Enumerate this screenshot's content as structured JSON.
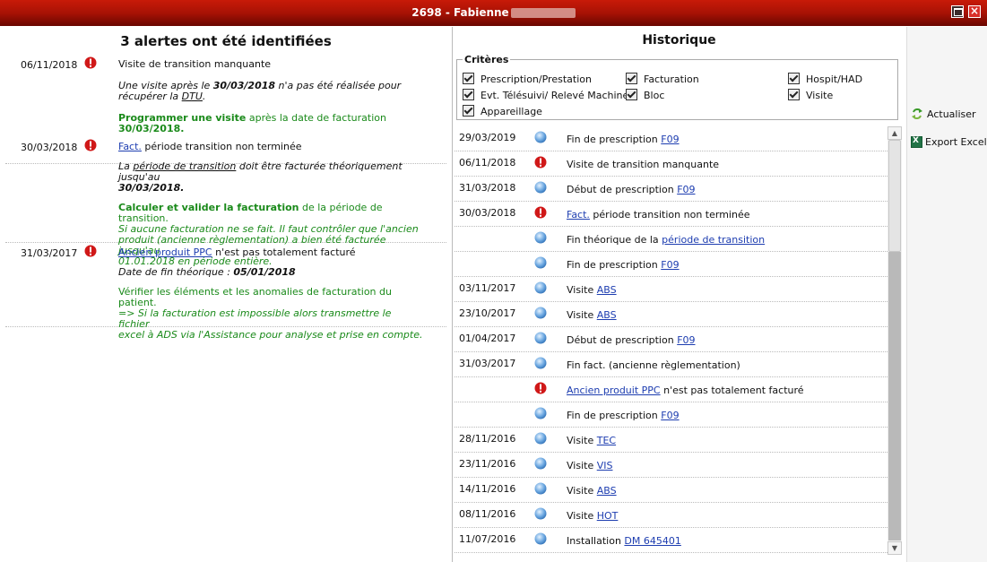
{
  "window": {
    "title": "2698 - Fabienne",
    "close_label": "×"
  },
  "alerts_panel": {
    "heading": "3 alertes ont été identifiées",
    "alerts": [
      {
        "date": "06/11/2018",
        "title": "Visite de transition manquante",
        "p1": "Une visite après le ",
        "p1b": "30/03/2018",
        "p1c": " n'a pas été réalisée pour",
        "p1d": "récupérer la ",
        "p1link": "DTU",
        "p1e": ".",
        "g1b": "Programmer une visite",
        "g1": " après la date de facturation",
        "g2b": "30/03/2018."
      },
      {
        "date": "30/03/2018",
        "title_link": "Fact.",
        "title": " période transition non terminée",
        "p1": "La ",
        "p1u": "période de transition",
        "p1c": " doit être facturée théoriquement jusqu'au",
        "p1b": "30/03/2018.",
        "g1b": "Calculer et valider la facturation",
        "g1": " de la période de transition.",
        "g2": "Si aucune facturation ne se fait. Il faut contrôler que l'ancien",
        "g3": "produit (ancienne règlementation) a bien été facturée jusqu'au",
        "g4": "01.01.2018 en période entière."
      },
      {
        "date": "31/03/2017",
        "title_link": "Ancien produit PPC",
        "title": " n'est pas totalement facturé",
        "p1": "Date de fin théorique : ",
        "p1b": "05/01/2018",
        "g1": "Vérifier les éléments et les anomalies de facturation du patient.",
        "g2": " => Si la facturation est impossible alors transmettre le fichier",
        "g3": "excel à ADS via l'Assistance pour analyse et prise en compte."
      }
    ]
  },
  "history_panel": {
    "heading": "Historique",
    "criteria_legend": "Critères",
    "criteria": [
      "Prescription/Prestation",
      "Facturation",
      "Hospit/HAD",
      "Evt. Télésuivi/ Relevé Machine",
      "Bloc",
      "Visite",
      "Appareillage"
    ],
    "rows": [
      {
        "date": "29/03/2019",
        "icon": "info",
        "text": "Fin de prescription ",
        "link": "F09",
        "after": ""
      },
      {
        "date": "06/11/2018",
        "icon": "error",
        "text": "Visite de transition manquante",
        "link": "",
        "after": ""
      },
      {
        "date": "31/03/2018",
        "icon": "info",
        "text": "Début de prescription ",
        "link": "F09",
        "after": ""
      },
      {
        "date": "30/03/2018",
        "icon": "error",
        "text": "",
        "link": "Fact.",
        "after": " période transition non terminée"
      },
      {
        "date": "",
        "icon": "info",
        "text": "Fin théorique de la ",
        "link": "période de transition",
        "after": ""
      },
      {
        "date": "",
        "icon": "info",
        "text": "Fin de prescription ",
        "link": "F09",
        "after": ""
      },
      {
        "date": "03/11/2017",
        "icon": "info",
        "text": "Visite ",
        "link": "ABS",
        "after": ""
      },
      {
        "date": "23/10/2017",
        "icon": "info",
        "text": "Visite ",
        "link": "ABS",
        "after": ""
      },
      {
        "date": "01/04/2017",
        "icon": "info",
        "text": "Début de prescription ",
        "link": "F09",
        "after": ""
      },
      {
        "date": "31/03/2017",
        "icon": "info",
        "text": "Fin fact. (ancienne règlementation)",
        "link": "",
        "after": ""
      },
      {
        "date": "",
        "icon": "error",
        "text": "",
        "link": "Ancien produit PPC",
        "after": " n'est pas totalement facturé"
      },
      {
        "date": "",
        "icon": "info",
        "text": "Fin de prescription ",
        "link": "F09",
        "after": ""
      },
      {
        "date": "28/11/2016",
        "icon": "info",
        "text": "Visite ",
        "link": "TEC",
        "after": ""
      },
      {
        "date": "23/11/2016",
        "icon": "info",
        "text": "Visite ",
        "link": "VIS",
        "after": ""
      },
      {
        "date": "14/11/2016",
        "icon": "info",
        "text": "Visite ",
        "link": "ABS",
        "after": ""
      },
      {
        "date": "08/11/2016",
        "icon": "info",
        "text": "Visite ",
        "link": "HOT",
        "after": ""
      },
      {
        "date": "11/07/2016",
        "icon": "info",
        "text": "Installation ",
        "link": "DM 645401",
        "after": ""
      }
    ]
  },
  "sidebar": {
    "refresh_label": "Actualiser",
    "export_label": "Export Excel"
  }
}
